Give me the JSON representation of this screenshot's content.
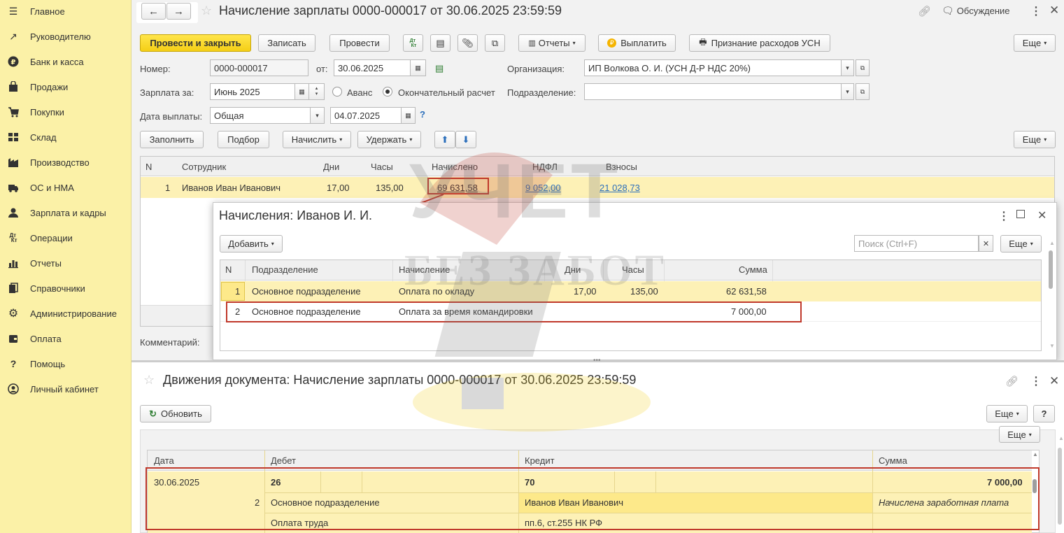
{
  "sidebar": {
    "items": [
      {
        "label": "Главное",
        "icon": "menu-icon"
      },
      {
        "label": "Руководителю",
        "icon": "trend-icon"
      },
      {
        "label": "Банк и касса",
        "icon": "ruble-icon"
      },
      {
        "label": "Продажи",
        "icon": "bag-icon"
      },
      {
        "label": "Покупки",
        "icon": "cart-icon"
      },
      {
        "label": "Склад",
        "icon": "warehouse-icon"
      },
      {
        "label": "Производство",
        "icon": "factory-icon"
      },
      {
        "label": "ОС и НМА",
        "icon": "truck-icon"
      },
      {
        "label": "Зарплата и кадры",
        "icon": "person-icon"
      },
      {
        "label": "Операции",
        "icon": "dt-kt-icon"
      },
      {
        "label": "Отчеты",
        "icon": "bar-chart-icon"
      },
      {
        "label": "Справочники",
        "icon": "books-icon"
      },
      {
        "label": "Администрирование",
        "icon": "gear-icon"
      },
      {
        "label": "Оплата",
        "icon": "wallet-icon"
      },
      {
        "label": "Помощь",
        "icon": "question-icon"
      },
      {
        "label": "Личный кабинет",
        "icon": "user-circle-icon"
      }
    ]
  },
  "doc": {
    "title": "Начисление зарплаты 0000-000017 от 30.06.2025 23:59:59",
    "discussion": "Обсуждение",
    "toolbar": {
      "post_close": "Провести и закрыть",
      "save": "Записать",
      "post": "Провести",
      "dtkt": "Дт Кт",
      "reports": "Отчеты",
      "pay": "Выплатить",
      "usn": "Признание расходов УСН",
      "more": "Еще"
    },
    "fields": {
      "number_label": "Номер:",
      "number": "0000-000017",
      "from_label": "от:",
      "date": "30.06.2025",
      "org_label": "Организация:",
      "org": "ИП Волкова О. И. (УСН Д-Р НДС 20%)",
      "salary_for_label": "Зарплата за:",
      "month": "Июнь 2025",
      "advance": "Аванс",
      "final": "Окончательный расчет",
      "dept_label": "Подразделение:",
      "dept": "",
      "pay_date_label": "Дата выплаты:",
      "pay_type": "Общая",
      "pay_date": "04.07.2025",
      "help": "?"
    },
    "table_toolbar": {
      "fill": "Заполнить",
      "select": "Подбор",
      "accrue": "Начислить",
      "withhold": "Удержать",
      "more": "Еще"
    },
    "table": {
      "headers": [
        "N",
        "Сотрудник",
        "Дни",
        "Часы",
        "Начислено",
        "НДФЛ",
        "Взносы"
      ],
      "rows": [
        [
          "1",
          "Иванов Иван Иванович",
          "17,00",
          "135,00",
          "69 631,58",
          "9 052,00",
          "21 028,73"
        ]
      ]
    },
    "comment_label": "Комментарий:"
  },
  "popup": {
    "title": "Начисления: Иванов И. И.",
    "add": "Добавить",
    "search_placeholder": "Поиск (Ctrl+F)",
    "more": "Еще",
    "headers": [
      "N",
      "Подразделение",
      "Начисление",
      "Дни",
      "Часы",
      "Сумма"
    ],
    "rows": [
      [
        "1",
        "Основное подразделение",
        "Оплата по окладу",
        "17,00",
        "135,00",
        "62 631,58"
      ],
      [
        "2",
        "Основное подразделение",
        "Оплата за время командировки",
        "",
        "",
        "7 000,00"
      ]
    ]
  },
  "movements": {
    "title": "Движения документа: Начисление зарплаты 0000-000017 от 30.06.2025 23:59:59",
    "refresh": "Обновить",
    "more": "Еще",
    "help": "?",
    "headers": [
      "Дата",
      "Дебет",
      "Кредит",
      "Сумма"
    ],
    "row1": {
      "date": "30.06.2025",
      "debit": "26",
      "credit": "70",
      "sum": "7 000,00"
    },
    "row2": {
      "n": "2",
      "debit": "Основное подразделение",
      "credit": "Иванов Иван Иванович",
      "note": "Начислена заработная плата"
    },
    "row3": {
      "debit": "Оплата труда",
      "credit": "пп.6, ст.255 НК РФ"
    }
  },
  "watermark": {
    "line1": "УЧЕТ",
    "line2": "БЕЗ ЗАБОТ"
  },
  "colors": {
    "accent": "#f5cf16",
    "row_highlight": "#fdf1b6",
    "annotation": "#c0392b",
    "sidebar": "#fbf1a7"
  }
}
